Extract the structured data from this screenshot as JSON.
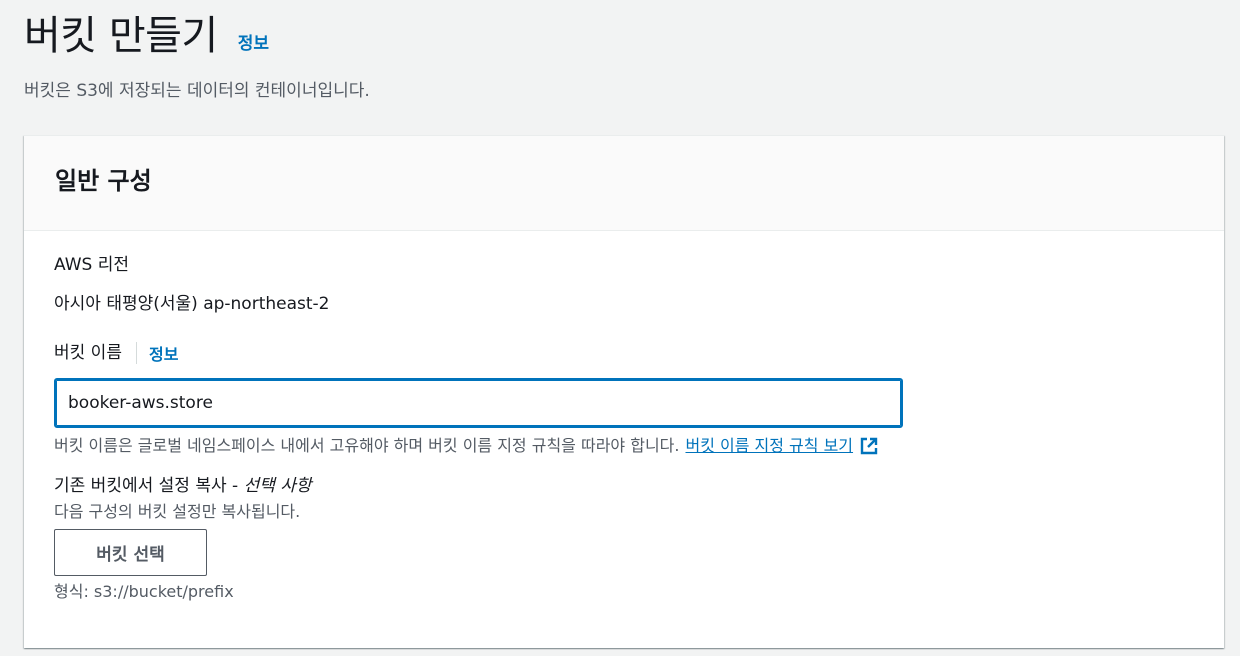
{
  "header": {
    "title": "버킷 만들기",
    "info_link": "정보",
    "description": "버킷은 S3에 저장되는 데이터의 컨테이너입니다."
  },
  "general_config": {
    "title": "일반 구성",
    "region": {
      "label": "AWS 리전",
      "value": "아시아 태평양(서울) ap-northeast-2"
    },
    "bucket_name": {
      "label": "버킷 이름",
      "info_link": "정보",
      "value": "booker-aws.store",
      "help_text": "버킷 이름은 글로벌 네임스페이스 내에서 고유해야 하며 버킷 이름 지정 규칙을 따라야 합니다.",
      "rules_link": "버킷 이름 지정 규칙 보기"
    },
    "copy_settings": {
      "label": "기존 버킷에서 설정 복사 - ",
      "optional": "선택 사항",
      "description": "다음 구성의 버킷 설정만 복사됩니다.",
      "button_label": "버킷 선택",
      "format_hint": "형식: s3://bucket/prefix"
    }
  },
  "colors": {
    "link": "#0073bb",
    "input_focus_border": "#0073bb",
    "page_background": "#f2f3f3"
  },
  "icons": {
    "external_link": "external-link-icon"
  }
}
